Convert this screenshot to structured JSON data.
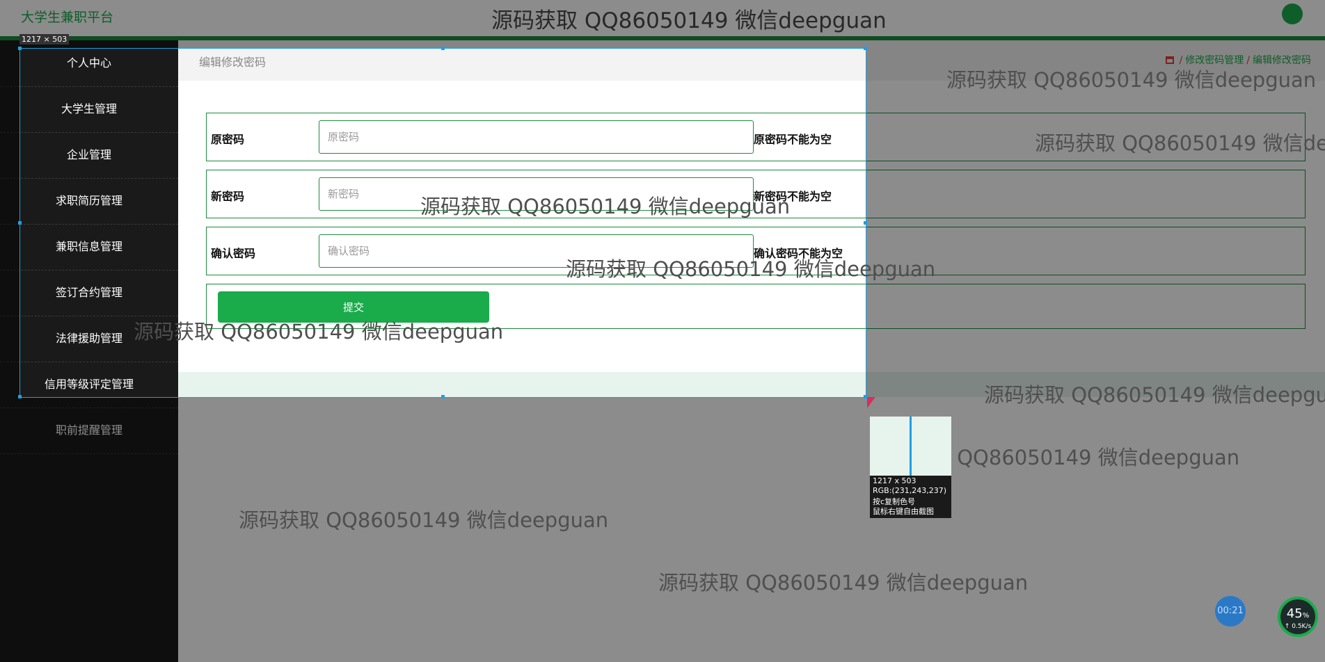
{
  "app": {
    "title": "大学生兼职平台"
  },
  "watermark": "源码获取 QQ86050149 微信deepguan",
  "sidebar": {
    "items": [
      {
        "label": "个人中心"
      },
      {
        "label": "大学生管理"
      },
      {
        "label": "企业管理"
      },
      {
        "label": "求职简历管理"
      },
      {
        "label": "兼职信息管理"
      },
      {
        "label": "签订合约管理"
      },
      {
        "label": "法律援助管理"
      },
      {
        "label": "信用等级评定管理"
      },
      {
        "label": "职前提醒管理"
      }
    ]
  },
  "card": {
    "title": "编辑修改密码"
  },
  "breadcrumb": {
    "items": [
      "修改密码管理",
      "编辑修改密码"
    ]
  },
  "form": {
    "fields": [
      {
        "label": "原密码",
        "placeholder": "原密码",
        "hint": "原密码不能为空"
      },
      {
        "label": "新密码",
        "placeholder": "新密码",
        "hint": "新密码不能为空"
      },
      {
        "label": "确认密码",
        "placeholder": "确认密码",
        "hint": "确认密码不能为空"
      }
    ],
    "submit_label": "提交"
  },
  "screenshot_tool": {
    "size_label": "1217 × 503",
    "magnifier": {
      "size": "1217 x 503",
      "rgb": "RGB:(231,243,237)",
      "copy_hint": "按c复制色号",
      "right_click_hint": "鼠标右键自由截图"
    }
  },
  "widgets": {
    "timer": "00:21",
    "gauge_percent": "45",
    "gauge_unit": "%",
    "net_speed": "↑ 0.5K/s"
  },
  "colors": {
    "accent": "#1aab4b",
    "dark_green": "#1d8a3c",
    "selection": "#1aa0e6",
    "sidebar_bg": "#1a1a1a"
  }
}
